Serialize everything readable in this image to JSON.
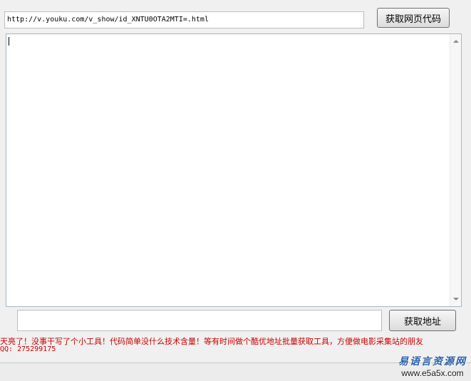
{
  "url_input": {
    "value": "http://v.youku.com/v_show/id_XNTU0OTA2MTI=.html"
  },
  "buttons": {
    "get_source": "获取网页代码",
    "get_address": "获取地址"
  },
  "source_textarea": {
    "value": ""
  },
  "address_input": {
    "value": ""
  },
  "info": {
    "line1": "天亮了！没事干写了个小工具！代码简单没什么技术含量！等有时间做个酷优地址批量获取工具，方便做电影采集站的朋友",
    "line2": "QQ: 275299175"
  },
  "watermark": {
    "logo": "易语言资源网",
    "url": "www.e5a5x.com"
  }
}
